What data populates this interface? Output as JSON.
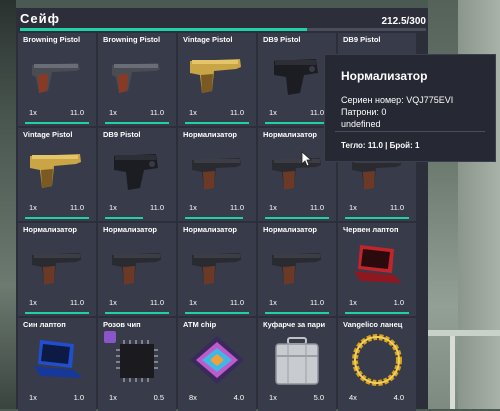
{
  "window": {
    "title": "Сейф",
    "weight": "212.5/300",
    "capacity_fraction": 0.708
  },
  "items": [
    {
      "name": "Browning Pistol",
      "qty": "1x",
      "weight": "11.0",
      "icon": "pistol-brown-icon",
      "durability": 1.0
    },
    {
      "name": "Browning Pistol",
      "qty": "1x",
      "weight": "11.0",
      "icon": "pistol-brown-icon",
      "durability": 1.0
    },
    {
      "name": "Vintage Pistol",
      "qty": "1x",
      "weight": "11.0",
      "icon": "pistol-gold-icon",
      "durability": 1.0
    },
    {
      "name": "DB9 Pistol",
      "qty": "1x",
      "weight": "11.0",
      "icon": "pistol-black-icon",
      "durability": 1.0
    },
    {
      "name": "DB9 Pistol",
      "qty": "",
      "weight": "",
      "icon": "pistol-black-icon",
      "durability": 1.0
    },
    {
      "name": "Vintage Pistol",
      "qty": "1x",
      "weight": "11.0",
      "icon": "pistol-gold-icon",
      "durability": 1.0
    },
    {
      "name": "DB9 Pistol",
      "qty": "1x",
      "weight": "11.0",
      "icon": "pistol-black-icon",
      "durability": 0.6
    },
    {
      "name": "Нормализатор",
      "qty": "1x",
      "weight": "11.0",
      "icon": "pistol-normalizer-icon",
      "durability": 0.9
    },
    {
      "name": "Нормализатор",
      "qty": "1x",
      "weight": "11.0",
      "icon": "pistol-normalizer-icon",
      "durability": 1.0
    },
    {
      "name": "",
      "qty": "1x",
      "weight": "11.0",
      "icon": "pistol-normalizer-icon",
      "durability": 1.0
    },
    {
      "name": "Нормализатор",
      "qty": "1x",
      "weight": "11.0",
      "icon": "pistol-normalizer-icon",
      "durability": 1.0
    },
    {
      "name": "Нормализатор",
      "qty": "1x",
      "weight": "11.0",
      "icon": "pistol-normalizer-icon",
      "durability": 1.0
    },
    {
      "name": "Нормализатор",
      "qty": "1x",
      "weight": "11.0",
      "icon": "pistol-normalizer-icon",
      "durability": 1.0
    },
    {
      "name": "Нормализатор",
      "qty": "1x",
      "weight": "11.0",
      "icon": "pistol-normalizer-icon",
      "durability": 1.0
    },
    {
      "name": "Червен лаптоп",
      "qty": "1x",
      "weight": "1.0",
      "icon": "red-laptop-icon",
      "durability": 1.0
    },
    {
      "name": "Син лаптоп",
      "qty": "1x",
      "weight": "1.0",
      "icon": "blue-laptop-icon",
      "durability": 0
    },
    {
      "name": "Розов чип",
      "qty": "1x",
      "weight": "0.5",
      "icon": "chip-icon",
      "durability": 0
    },
    {
      "name": "ATM chip",
      "qty": "8x",
      "weight": "4.0",
      "icon": "atm-chip-icon",
      "durability": 0
    },
    {
      "name": "Куфарче за пари",
      "qty": "1x",
      "weight": "5.0",
      "icon": "briefcase-icon",
      "durability": 0
    },
    {
      "name": "Vangelico ланец",
      "qty": "4x",
      "weight": "4.0",
      "icon": "gold-chain-icon",
      "durability": 0
    }
  ],
  "tooltip": {
    "name": "Нормализатор",
    "serial": "Сериен номер: VQJ775EVI",
    "ammo": "Патрони: 0",
    "extra": "undefined",
    "footer": "Тегло: 11.0 | Брой: 1",
    "overlay_name": "Нормализатор"
  },
  "colors": {
    "accent": "#1fd1a6",
    "panel": "#2c2e39",
    "cell": "#383b49"
  }
}
